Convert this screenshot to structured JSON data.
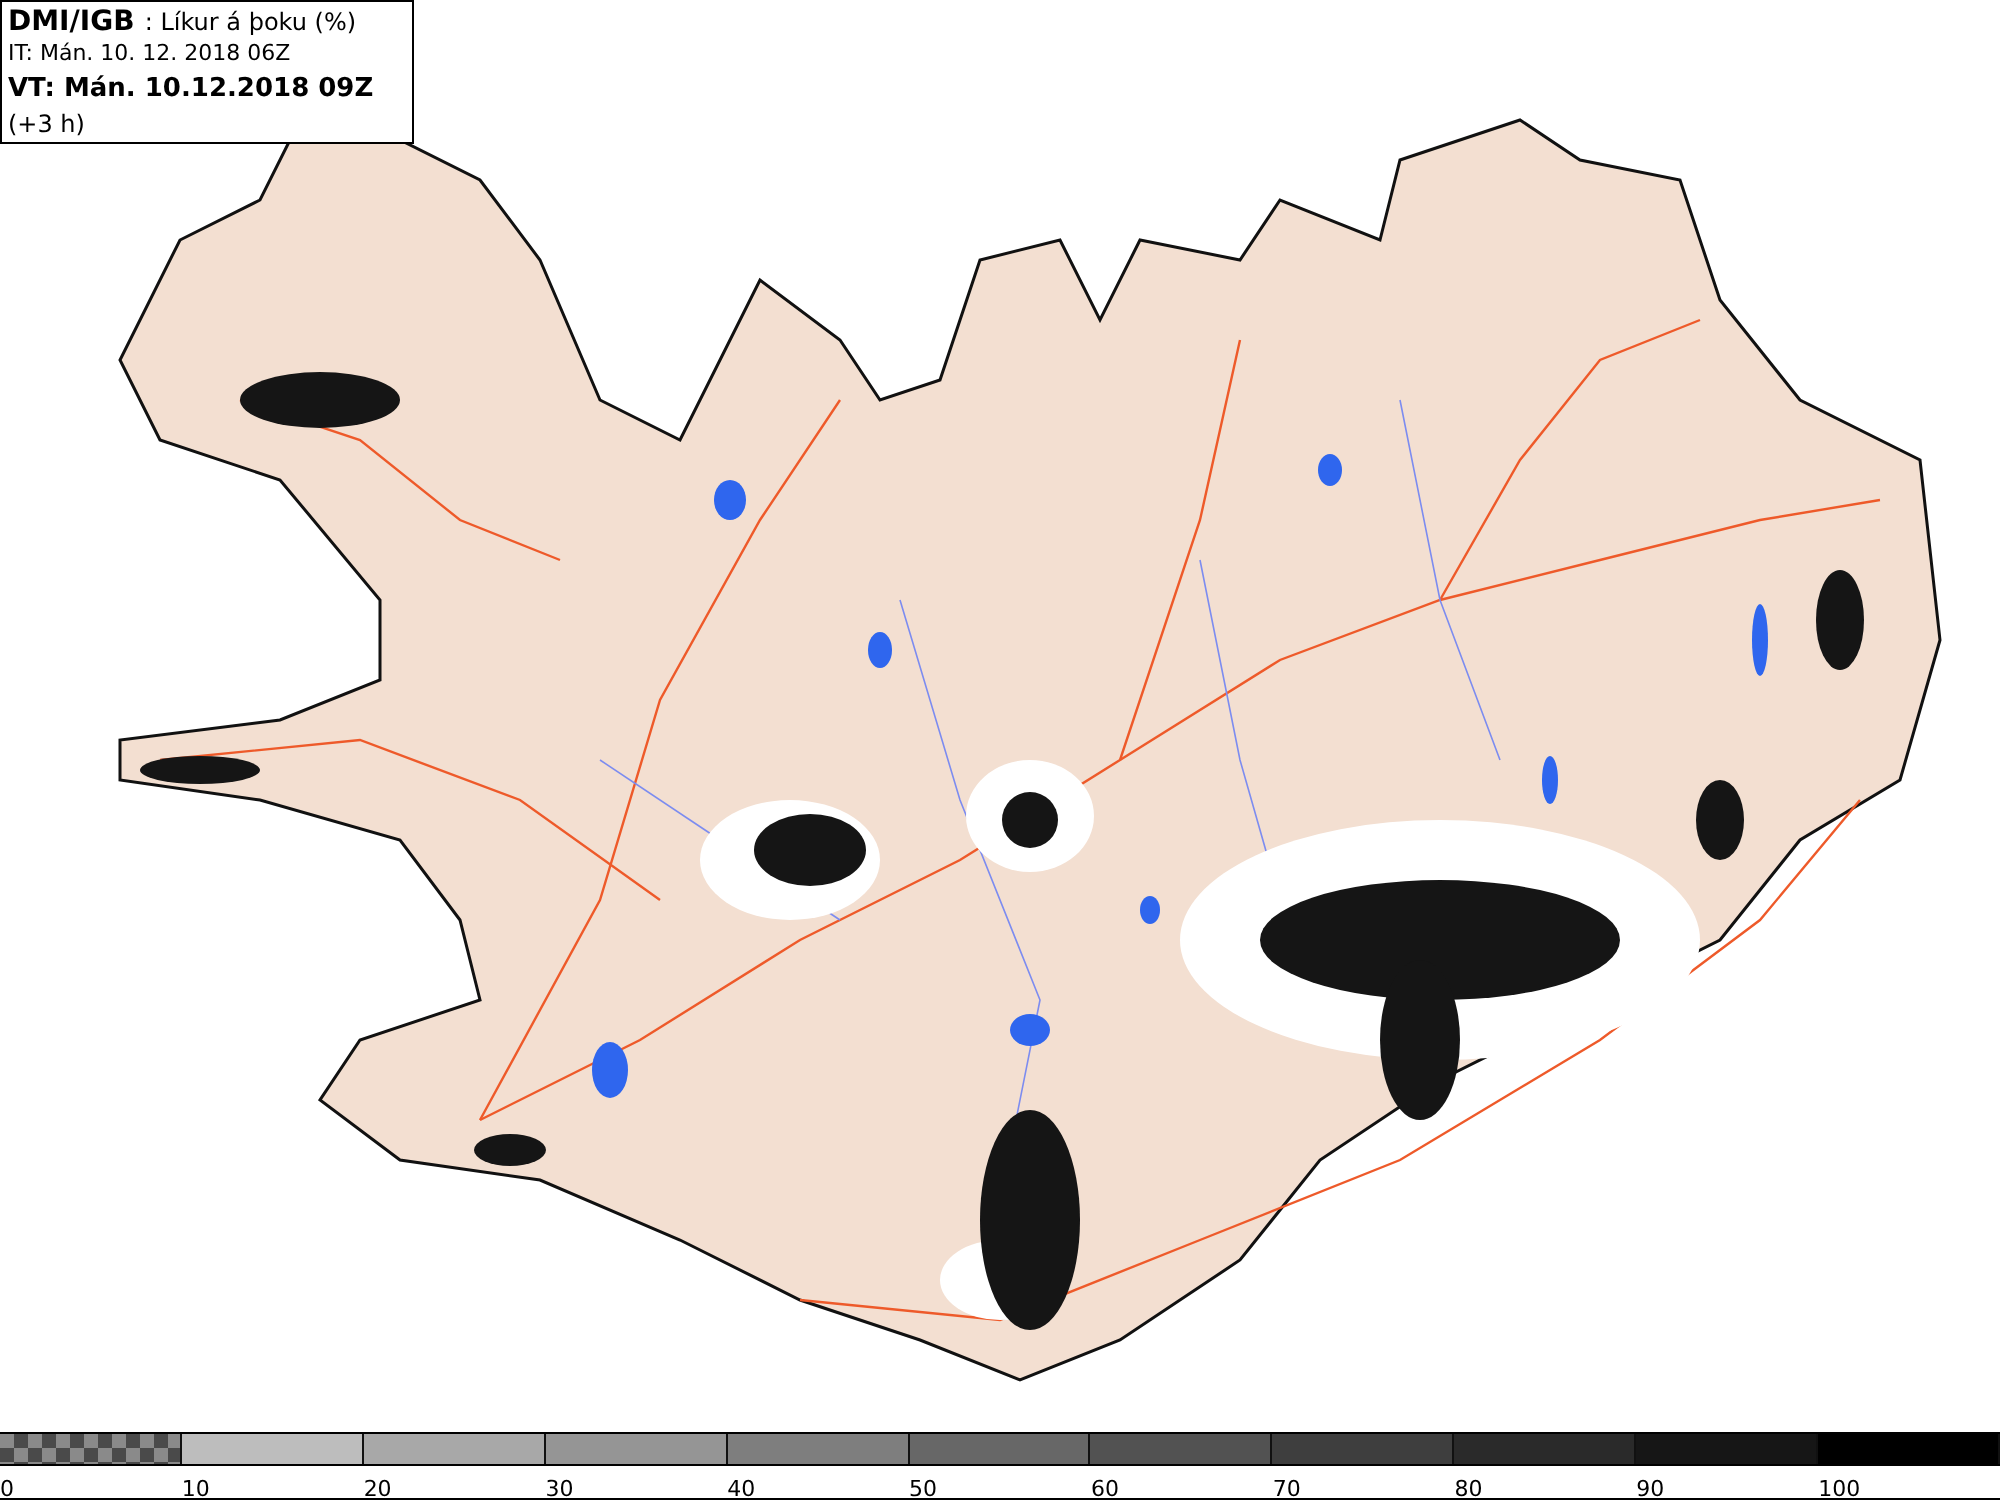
{
  "header": {
    "source": "DMI/IGB",
    "title": ": Líkur á þoku (%)",
    "issue_time": "IT: Mán. 10. 12. 2018 06Z",
    "valid_time": "VT: Mán. 10.12.2018 09Z",
    "offset": "(+3 h)"
  },
  "legend": {
    "segments": [
      {
        "kind": "checkered",
        "color": "#4a4a4a"
      },
      {
        "kind": "solid",
        "color": "#bdbdbd"
      },
      {
        "kind": "solid",
        "color": "#a8a8a8"
      },
      {
        "kind": "solid",
        "color": "#959595"
      },
      {
        "kind": "solid",
        "color": "#7e7e7e"
      },
      {
        "kind": "solid",
        "color": "#676767"
      },
      {
        "kind": "solid",
        "color": "#525252"
      },
      {
        "kind": "solid",
        "color": "#3e3e3e"
      },
      {
        "kind": "solid",
        "color": "#2a2a2a"
      },
      {
        "kind": "solid",
        "color": "#161616"
      },
      {
        "kind": "solid",
        "color": "#000000"
      }
    ],
    "labels": [
      "0",
      "10",
      "20",
      "30",
      "40",
      "50",
      "60",
      "70",
      "80",
      "90",
      "100"
    ]
  }
}
